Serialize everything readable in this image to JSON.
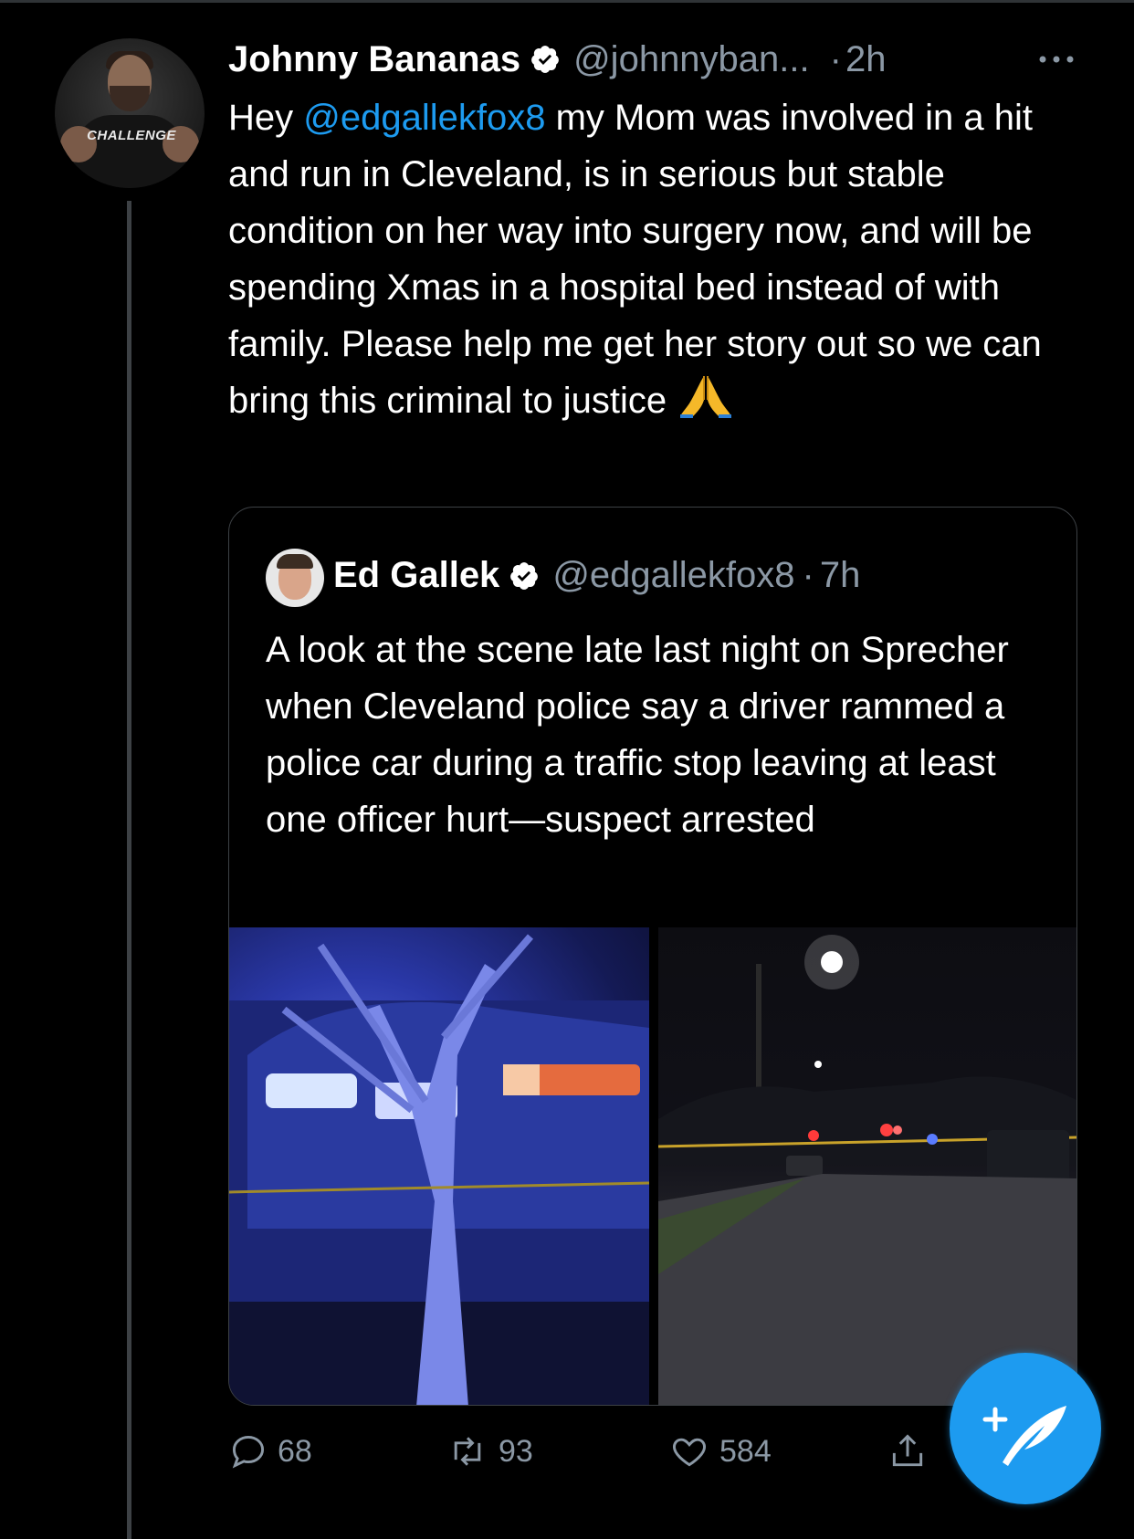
{
  "tweet": {
    "author_name": "Johnny Bananas",
    "author_handle": "@johnnyban...",
    "separator": "·",
    "time": "2h",
    "avatar_shirt_text": "CHALLENGE",
    "text_prefix": "Hey ",
    "mention": "@edgallekfox8",
    "text_body": " my Mom was involved in a hit and run in Cleveland, is in serious but stable condition on her way into surgery now, and will be spending Xmas in a hospital bed instead of with family. Please help me get her story out so we can bring this criminal to justice ",
    "emoji": "folded-hands",
    "more_icon": "more-icon"
  },
  "quoted_tweet": {
    "author_name": "Ed Gallek",
    "author_handle": "@edgallekfox8",
    "separator": "·",
    "time": "7h",
    "text": "A look at the scene late last night on Sprecher when Cleveland police say a driver rammed a police car during a traffic stop leaving at least one officer hurt—suspect arrested",
    "images": [
      {
        "name": "crashed-car-photo",
        "desc": "crashed SUV against a tree under blue police lights"
      },
      {
        "name": "street-scene-photo",
        "desc": "night street with police lights and caution tape"
      }
    ]
  },
  "actions": {
    "replies": "68",
    "retweets": "93",
    "likes": "584"
  },
  "colors": {
    "background": "#000000",
    "accent": "#1d9bf0",
    "secondary_text": "#8b98a5",
    "border": "#3d4145"
  },
  "compose_button": {
    "icon": "compose-feather-icon",
    "label": "+"
  }
}
